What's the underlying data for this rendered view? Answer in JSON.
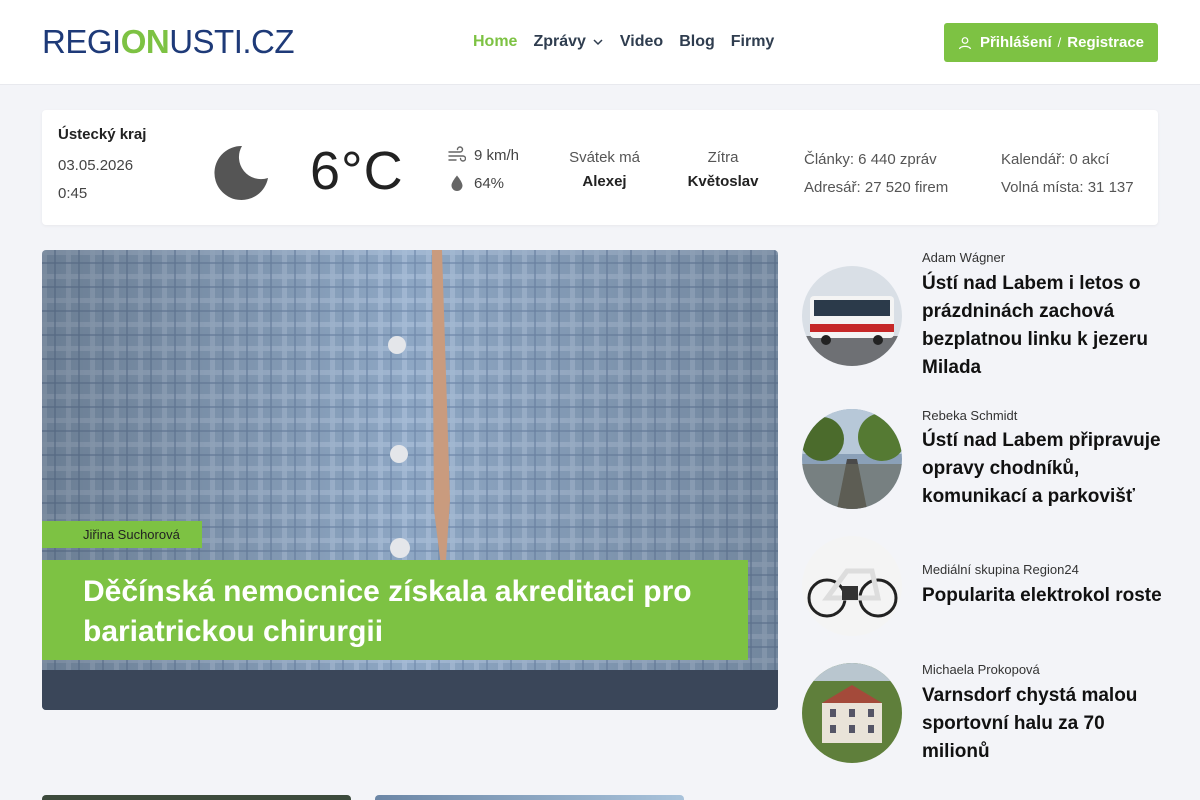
{
  "header": {
    "logo_text_1": "REGI",
    "logo_text_2": "ON",
    "logo_text_3": "USTI.CZ",
    "nav": [
      {
        "label": "Home"
      },
      {
        "label": "Zprávy"
      },
      {
        "label": "Video"
      },
      {
        "label": "Blog"
      },
      {
        "label": "Firmy"
      }
    ],
    "login_label": "Přihlášení",
    "login_sep": "/",
    "register_label": "Registrace"
  },
  "info": {
    "region": "Ústecký kraj",
    "date": "03.05.2026",
    "time": "0:45",
    "weather_icon": "moon-icon",
    "temperature": "6°C",
    "wind": "9 km/h",
    "humidity": "64%",
    "nameday_label": "Svátek má",
    "nameday_name": "Alexej",
    "tomorrow_label": "Zítra",
    "tomorrow_name": "Květoslav",
    "articles": "Články: 6 440 zpráv",
    "directory": "Adresář: 27 520 firem",
    "calendar": "Kalendář: 0 akcí",
    "jobs": "Volná místa: 31 137"
  },
  "main_article": {
    "author": "Jiřina Suchorová",
    "title": "Děčínská nemocnice získala akreditaci pro bariatrickou chirurgii"
  },
  "side_articles": [
    {
      "author": "Adam Wágner",
      "title": "Ústí nad Labem i letos o prázdninách zachová bezplatnou linku k jezeru Milada"
    },
    {
      "author": "Rebeka Schmidt",
      "title": "Ústí nad Labem připravuje opravy chodníků, komunikací a parkovišť"
    },
    {
      "author": "Mediální skupina Region24",
      "title": "Popularita elektrokol roste"
    },
    {
      "author": "Michaela Prokopová",
      "title": "Varnsdorf chystá malou sportovní halu za 70 milionů"
    }
  ],
  "colors": {
    "accent": "#7dc243",
    "brand_blue": "#1e3a78"
  }
}
